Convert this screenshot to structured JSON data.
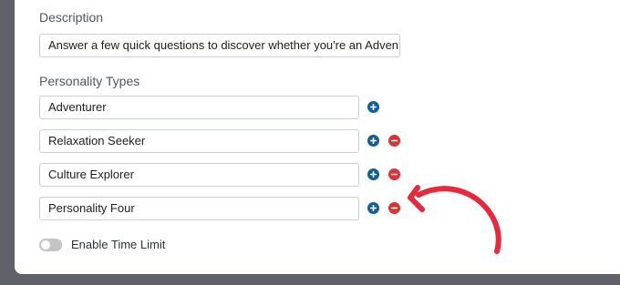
{
  "description": {
    "label": "Description",
    "value": "Answer a few quick questions to discover whether you're an Adven"
  },
  "personality_types": {
    "label": "Personality Types",
    "items": [
      {
        "value": "Adventurer",
        "has_remove": false
      },
      {
        "value": "Relaxation Seeker",
        "has_remove": true
      },
      {
        "value": "Culture Explorer",
        "has_remove": true
      },
      {
        "value": "Personality Four",
        "has_remove": true
      }
    ]
  },
  "time_limit": {
    "label": "Enable Time Limit",
    "enabled": false
  },
  "icons": {
    "add": "plus-circle-icon",
    "remove": "minus-circle-icon",
    "annotation": "red-arrow-annotation"
  },
  "colors": {
    "add_button": "#135e96",
    "remove_button": "#d63638",
    "annotation": "#e8283c",
    "backdrop": "#5f6268"
  }
}
